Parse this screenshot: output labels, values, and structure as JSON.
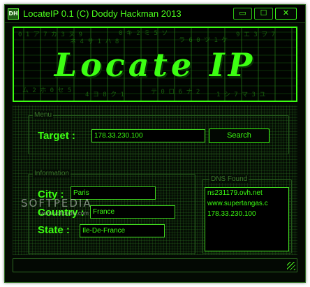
{
  "window": {
    "title": "LocateIP 0.1 (C) Doddy Hackman 2013",
    "icon_text": "DH",
    "minimize_glyph": "▭",
    "maximize_glyph": "☐",
    "close_glyph": "✕"
  },
  "banner": {
    "title": "Locate IP"
  },
  "menu": {
    "legend": "Menu",
    "target_label": "Target :",
    "target_value": "178.33.230.100",
    "search_label": "Search"
  },
  "information": {
    "legend": "Information",
    "city_label": "City :",
    "city_value": "Paris",
    "country_label": "Country :",
    "country_value": "France",
    "state_label": "State :",
    "state_value": "Ile-De-France"
  },
  "dns": {
    "legend": "DNS Found",
    "items": [
      "ns231179.ovh.net",
      "www.supertangas.c",
      "178.33.230.100"
    ]
  },
  "watermark": {
    "text": "SOFTPEDIA",
    "url": "www.softpedia.com"
  },
  "colors": {
    "accent": "#3cff12",
    "background": "#050d04",
    "border": "#2e6b22"
  }
}
